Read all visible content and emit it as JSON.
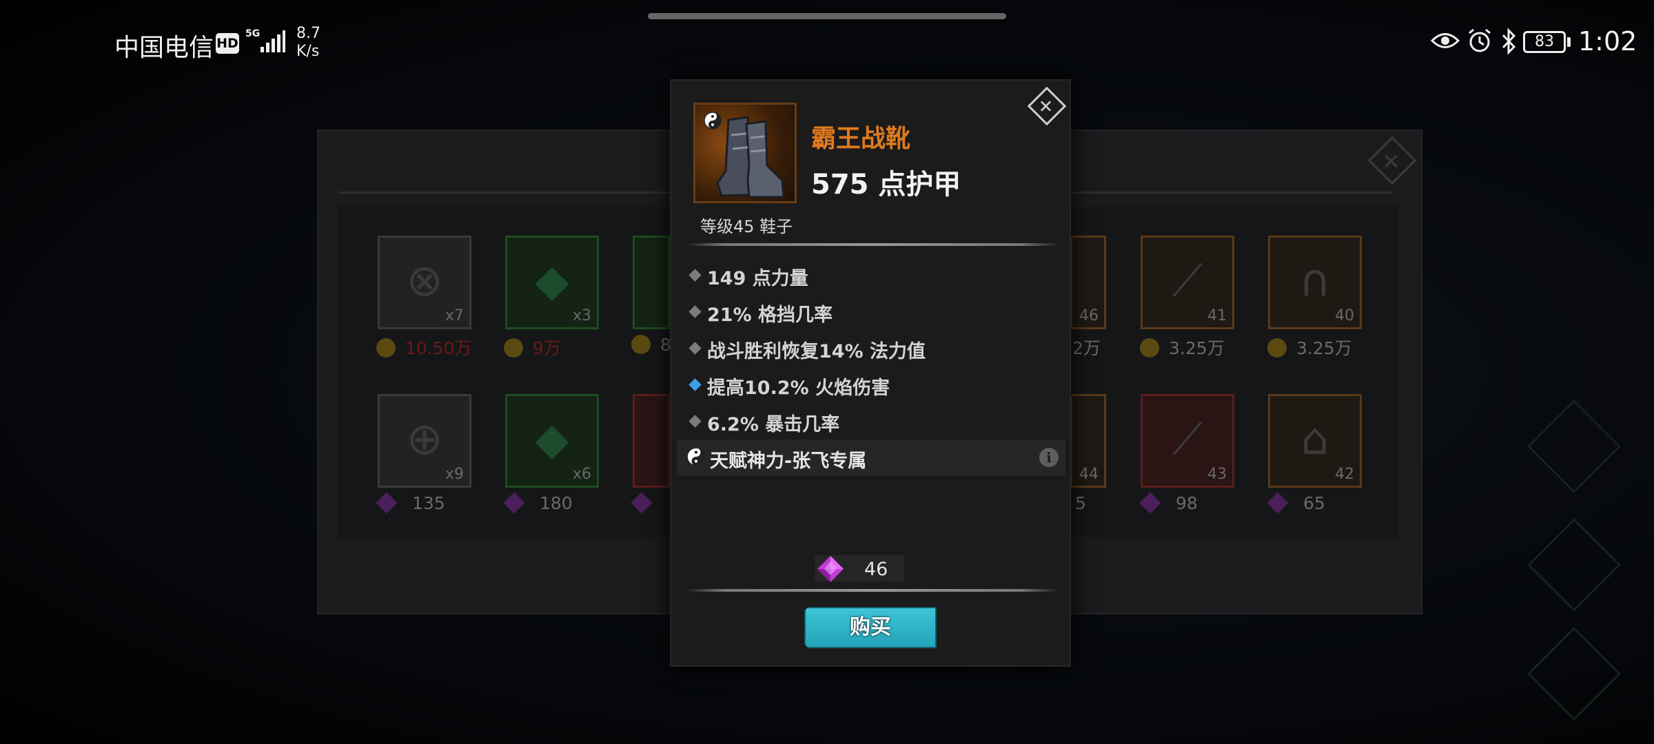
{
  "status_bar": {
    "carrier": "中国电信",
    "hd_badge": "HD",
    "network": "5G",
    "net_speed_value": "8.7",
    "net_speed_unit": "K/s",
    "battery_level": "83",
    "time": "1:02",
    "icons": [
      "eye-icon",
      "alarm-icon",
      "bluetooth-icon",
      "battery-icon"
    ]
  },
  "shop_background": {
    "row1": [
      {
        "count": "x7",
        "price": "10.50万",
        "currency": "coin",
        "price_color": "#6a1a1a"
      },
      {
        "count": "x3",
        "price": "9万",
        "currency": "coin",
        "price_color": "#6a1a1a"
      },
      {
        "count": "",
        "price": "8",
        "currency": "coin"
      },
      {
        "count": "46",
        "price": "2万",
        "currency": "coin"
      },
      {
        "count": "41",
        "price": "3.25万",
        "currency": "coin"
      },
      {
        "count": "40",
        "price": "3.25万",
        "currency": "coin"
      }
    ],
    "row2": [
      {
        "count": "x9",
        "price": "135",
        "currency": "gem"
      },
      {
        "count": "x6",
        "price": "180",
        "currency": "gem"
      },
      {
        "count": "",
        "price": "",
        "currency": "gem"
      },
      {
        "count": "44",
        "price": "5",
        "currency": "gem"
      },
      {
        "count": "43",
        "price": "98",
        "currency": "gem"
      },
      {
        "count": "42",
        "price": "65",
        "currency": "gem"
      }
    ]
  },
  "item": {
    "name": "霸王战靴",
    "main_stat": "575 点护甲",
    "level_type": "等级45 鞋子",
    "stats": [
      {
        "text": "149 点力量",
        "bullet": "gray"
      },
      {
        "text": "21% 格挡几率",
        "bullet": "gray"
      },
      {
        "text": "战斗胜利恢复14% 法力值",
        "bullet": "gray"
      },
      {
        "text": "提高10.2% 火焰伤害",
        "bullet": "blue"
      },
      {
        "text": "6.2% 暴击几率",
        "bullet": "gray"
      }
    ],
    "talent": "天赋神力-张飞专属",
    "price": "46",
    "buy_label": "购买",
    "colors": {
      "name": "#e07a1e",
      "accent_bullet": "#3aa0e8",
      "buy_button": "#2fb6ca"
    }
  }
}
